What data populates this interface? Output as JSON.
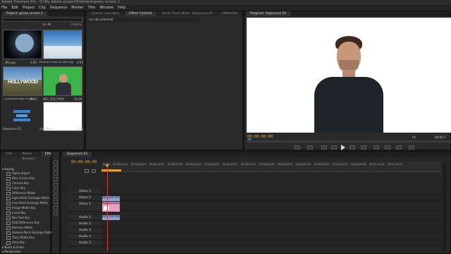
{
  "window": {
    "title": "Adobe Premiere Pro - D:\\My Adobe project\\Premiere\\green screen 1"
  },
  "menu": [
    "File",
    "Edit",
    "Project",
    "Clip",
    "Sequence",
    "Marker",
    "Title",
    "Window",
    "Help"
  ],
  "project_panel": {
    "tab": "Project: green screen 1",
    "search_label": "In:",
    "search_value": "All",
    "item_count": "6 Items",
    "items": [
      {
        "name": "...JPG.jpg",
        "duration": "4:00",
        "thumb": "earth"
      },
      {
        "name": "Pixabay 9-dan-i-a-4ee1.jpg",
        "duration": "4:00",
        "thumb": "sky"
      },
      {
        "name": "...hollywood-sign-14.jpg",
        "duration": "4:00",
        "thumb": "hollywood"
      },
      {
        "name": "IMG_5567.MOV",
        "duration": "20:00",
        "thumb": "greenscreen"
      },
      {
        "name": "Sequence 01",
        "duration": "",
        "thumb": "sequence"
      },
      {
        "name": "Solid Bun",
        "duration": "5:00",
        "thumb": "white"
      }
    ]
  },
  "source_panel": {
    "tabs": [
      "Source: (no clips)",
      "Effect Controls",
      "Audio Track Mixer: Sequence 01",
      "Metadata"
    ],
    "active_tab": 1,
    "clip_label": "(no clip selected)"
  },
  "program_monitor": {
    "tab": "Program: Sequence 01",
    "timecode": "00;00;00;00",
    "zoom": "Fit",
    "duration": "00;00;1"
  },
  "effects_panel": {
    "tabs": [
      "Info",
      "Media Browser",
      "Effects"
    ],
    "group": "Keying",
    "items": [
      "Alpha Adjust",
      "Blue Screen Key",
      "Chroma Key",
      "Color Key",
      "Difference Matte",
      "Eight-Point Garbage Matte",
      "Four-Point Garbage Matte",
      "Image Matte Key",
      "Luma Key",
      "Non Red Key",
      "RGB Difference Key",
      "Remove Matte",
      "Sixteen-Point Garbage Matte",
      "Track Matte Key",
      "Ultra Key"
    ],
    "group2": "Noise & Grain",
    "group3": "Perspective"
  },
  "timeline": {
    "tab": "Sequence 01",
    "timecode": "00;00;00;00",
    "ticks": [
      "00;00",
      "00;00;04;23",
      "00;00;09;23",
      "00;00;14;22",
      "00;00;19;22",
      "00;00;24;22",
      "00;00;29;21",
      "00;00;34;21",
      "00;00;39;21",
      "00;00;44;20",
      "00;00;49;20",
      "00;00;54;20",
      "00;00;59;19",
      "00;01;04;19",
      "00;01;09;18",
      "00;01;14;18",
      "00;01;19;17"
    ],
    "video_tracks": [
      "Video 3",
      "Video 2",
      "Video 1"
    ],
    "audio_tracks": [
      "Audio 1",
      "Audio 2",
      "Audio 3",
      "Audio 4",
      "Audio 5"
    ],
    "clips": {
      "v2": "IMG_5567.MOV",
      "v1": "Pixabay 9-dan",
      "a1": "IMG_5567.MOV"
    }
  },
  "colors": {
    "accent": "#e5a437",
    "playhead": "#d13a3a",
    "clip_blue": "#8aa3d6",
    "clip_pink": "#e59fc2"
  }
}
